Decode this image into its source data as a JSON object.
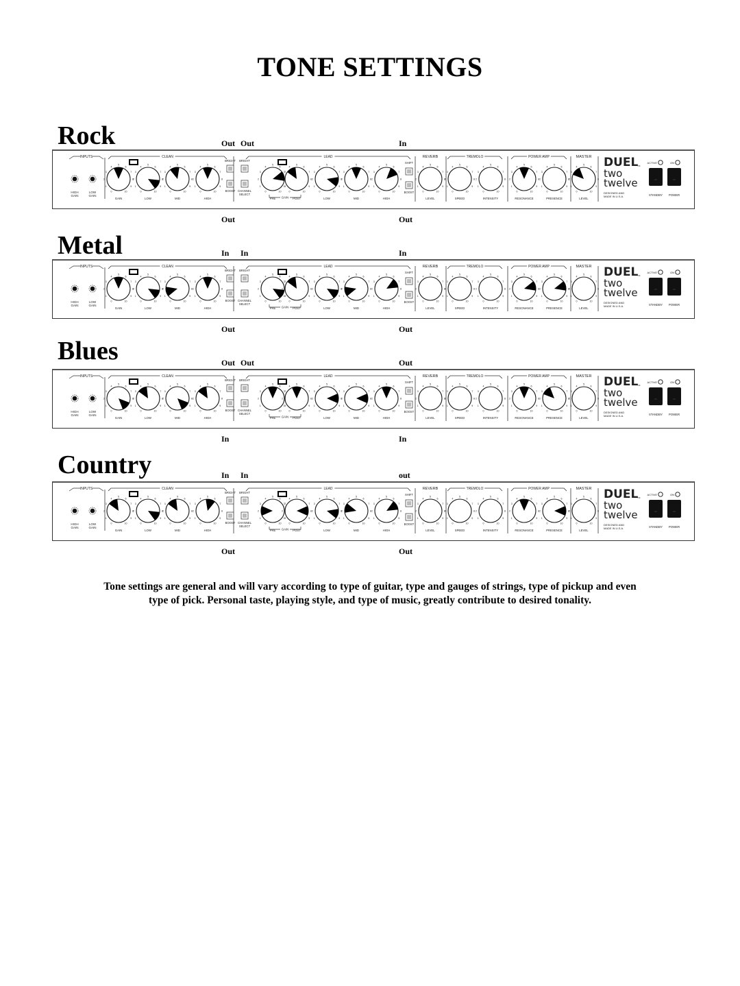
{
  "page": {
    "title": "TONE SETTINGS",
    "note": "Tone settings are general and will vary according to type of guitar, type and gauges of strings, type of pickup and even type of pick. Personal taste, playing style, and type of music, greatly contribute to desired tonality."
  },
  "panel_labels": {
    "inputs": "INPUTS",
    "high_gain": [
      "HIGH",
      "GAIN"
    ],
    "low_gain": [
      "LOW",
      "GAIN"
    ],
    "clean": "CLEAN",
    "lead": "LEAD",
    "reverb": "REVERB",
    "tremolo": "TREMOLO",
    "power_amp": "POWER AMP",
    "master": "MASTER",
    "gain_bracket": "GAIN",
    "bright": "BRIGHT",
    "boost": "BOOST",
    "channel_select": [
      "CHANNEL",
      "SELECT"
    ],
    "shift": "SHIFT",
    "brand": "DUEL",
    "model_line1": "two",
    "model_line2": "twelve",
    "tm": "TM",
    "designed": [
      "DESIGNED AND",
      "MADE IN U.S.A."
    ],
    "active": "ACTIVE",
    "on": "ON",
    "standby": "STANDBY",
    "power": "POWER",
    "knob_labels": {
      "clean_gain": "GAIN",
      "clean_low": "LOW",
      "clean_mid": "MID",
      "clean_high": "HIGH",
      "lead_pre": "PRE",
      "lead_post": "POST",
      "lead_low": "LOW",
      "lead_mid": "MID",
      "lead_high": "HIGH",
      "reverb_level": "LEVEL",
      "tremolo_speed": "SPEED",
      "tremolo_intensity": "INTENSITY",
      "power_resonance": "RESONANCE",
      "power_presence": "PRESENCE",
      "master_level": "LEVEL"
    }
  },
  "knob_order": [
    "clean_gain",
    "clean_low",
    "clean_mid",
    "clean_high",
    "lead_pre",
    "lead_post",
    "lead_low",
    "lead_mid",
    "lead_high",
    "reverb_level",
    "tremolo_speed",
    "tremolo_intensity",
    "power_resonance",
    "power_presence",
    "master_level"
  ],
  "presets": [
    {
      "name": "Rock",
      "switches": {
        "clean_bright": "Out",
        "lead_bright": "Out",
        "clean_boost": "Out",
        "lead_shift": "In",
        "lead_boost": "Out"
      },
      "knobs": {
        "clean_gain": 5,
        "clean_low": 9,
        "clean_mid": 4.5,
        "clean_high": 5,
        "lead_pre": 7.5,
        "lead_post": 4,
        "lead_low": 8.5,
        "lead_mid": 5,
        "lead_high": 6.5,
        "reverb_level": null,
        "tremolo_speed": null,
        "tremolo_intensity": null,
        "power_resonance": 5,
        "power_presence": null,
        "master_level": 3.5
      }
    },
    {
      "name": "Metal",
      "switches": {
        "clean_bright": "In",
        "lead_bright": "In",
        "clean_boost": "Out",
        "lead_shift": "In",
        "lead_boost": "Out"
      },
      "knobs": {
        "clean_gain": 5,
        "clean_low": 9,
        "clean_mid": 1.5,
        "clean_high": 5,
        "lead_pre": 9,
        "lead_post": 4,
        "lead_low": 9,
        "lead_mid": 1.5,
        "lead_high": 7,
        "reverb_level": null,
        "tremolo_speed": null,
        "tremolo_intensity": null,
        "power_resonance": 7.5,
        "power_presence": 7.5,
        "master_level": null
      }
    },
    {
      "name": "Blues",
      "switches": {
        "clean_bright": "Out",
        "lead_bright": "Out",
        "clean_boost": "In",
        "lead_shift": "Out",
        "lead_boost": "In"
      },
      "knobs": {
        "clean_gain": 9.5,
        "clean_low": 4,
        "clean_mid": 9.5,
        "clean_high": 4,
        "lead_pre": 5,
        "lead_post": 5,
        "lead_low": 8,
        "lead_mid": 8,
        "lead_high": 5,
        "reverb_level": null,
        "tremolo_speed": null,
        "tremolo_intensity": null,
        "power_resonance": 5,
        "power_presence": 3.5,
        "master_level": null
      }
    },
    {
      "name": "Country",
      "switches": {
        "clean_bright": "In",
        "lead_bright": "In",
        "clean_boost": "Out",
        "lead_shift": "out",
        "lead_boost": "Out"
      },
      "knobs": {
        "clean_gain": 4,
        "clean_low": 9,
        "clean_mid": 4,
        "clean_high": 5.5,
        "lead_pre": 2,
        "lead_post": 8,
        "lead_low": 8.5,
        "lead_mid": 2.5,
        "lead_high": 7,
        "reverb_level": null,
        "tremolo_speed": null,
        "tremolo_intensity": null,
        "power_resonance": 5,
        "power_presence": 8,
        "master_level": null
      }
    }
  ]
}
